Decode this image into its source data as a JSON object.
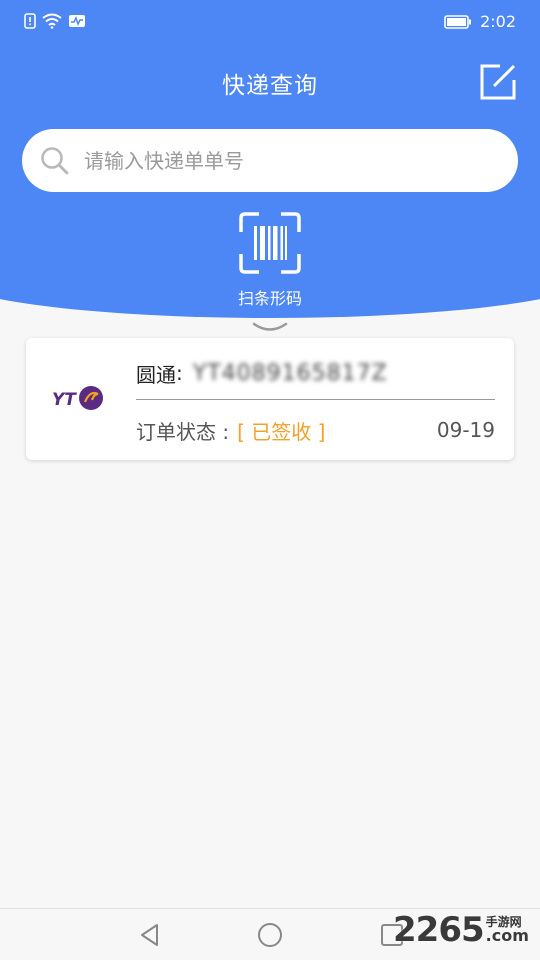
{
  "status_bar": {
    "time": "2:02",
    "left_icons": [
      "alert-icon",
      "wifi-icon",
      "activity-icon"
    ],
    "right_icons": [
      "battery-icon"
    ]
  },
  "header": {
    "title": "快递查询",
    "edit_icon": "edit-icon"
  },
  "search": {
    "placeholder": "请输入快递单单号",
    "value": ""
  },
  "scan": {
    "label": "扫条形码",
    "icon": "barcode-scan-icon"
  },
  "orders": [
    {
      "carrier": "圆通",
      "separator": " :",
      "tracking_number": "YT4089165817Z",
      "status_label": "订单状态 :",
      "status_value": "[ 已签收 ]",
      "date": "09-19",
      "logo_text": "YT"
    }
  ],
  "nav": {
    "icons": [
      "back-icon",
      "home-icon",
      "recents-icon"
    ]
  },
  "watermark": {
    "number": "2265",
    "cn_text": "手游网",
    "suffix": ".com"
  },
  "colors": {
    "primary": "#4d86f5",
    "status": "#f0a22b",
    "background": "#f7f7f7"
  }
}
